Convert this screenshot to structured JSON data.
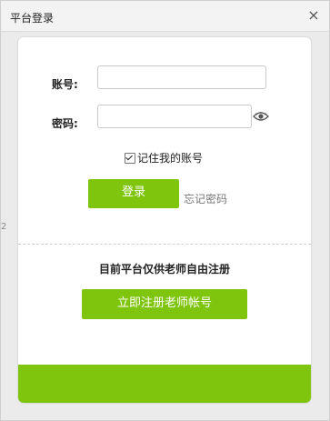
{
  "window": {
    "title": "平台登录",
    "close_glyph": "×"
  },
  "side_glyph": "2",
  "form": {
    "account_label": "账号:",
    "account_value": "",
    "password_label": "密码:",
    "password_value": "",
    "remember_label": "记住我的账号",
    "remember_checked": true,
    "login_button": "登录",
    "forgot_link": "忘记密码"
  },
  "register": {
    "notice": "目前平台仅供老师自由注册",
    "button": "立即注册老师帐号"
  },
  "colors": {
    "accent": "#7fc40d",
    "background": "#ebebeb",
    "card": "#ffffff"
  },
  "icons": {
    "close": "close-icon",
    "password_toggle": "eye-icon",
    "remember_checkbox": "checkbox-checked"
  }
}
